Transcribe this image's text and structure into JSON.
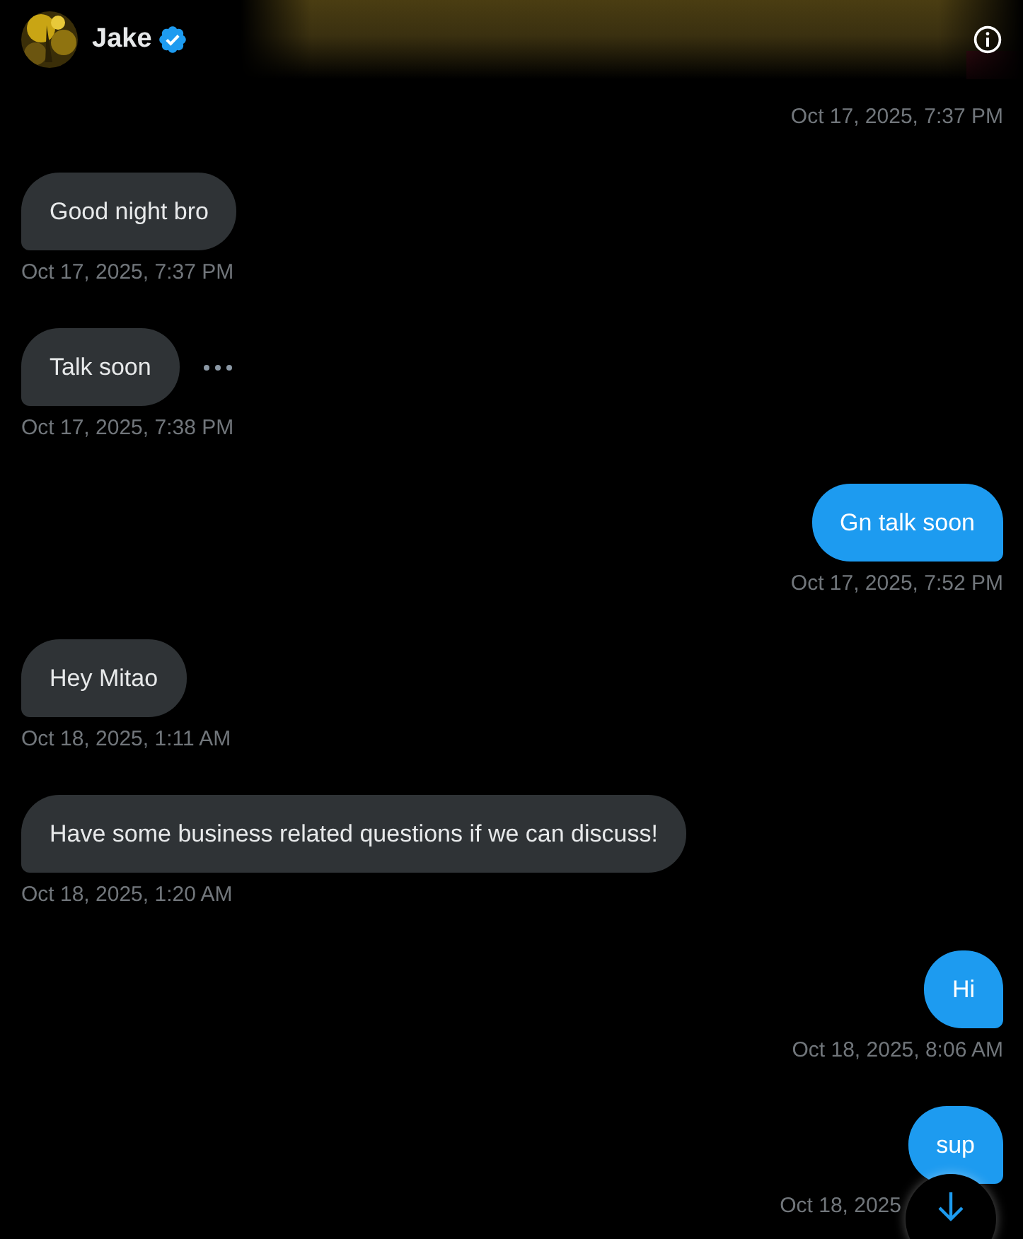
{
  "header": {
    "name": "Jake",
    "verified": true
  },
  "top_timestamp": "Oct 17, 2025, 7:37 PM",
  "messages": [
    {
      "text": "Good night bro",
      "sent": false,
      "show_more": false,
      "timestamp": "Oct 17, 2025, 7:37 PM"
    },
    {
      "text": "Talk soon",
      "sent": false,
      "show_more": true,
      "timestamp": "Oct 17, 2025, 7:38 PM"
    },
    {
      "text": "Gn talk soon",
      "sent": true,
      "show_more": false,
      "timestamp": "Oct 17, 2025, 7:52 PM"
    },
    {
      "text": "Hey Mitao",
      "sent": false,
      "show_more": false,
      "timestamp": "Oct 18, 2025, 1:11 AM"
    },
    {
      "text": "Have some business related questions if we can discuss!",
      "sent": false,
      "show_more": false,
      "timestamp": "Oct 18, 2025, 1:20 AM"
    },
    {
      "text": "Hi",
      "sent": true,
      "show_more": false,
      "timestamp": "Oct 18, 2025, 8:06 AM"
    },
    {
      "text": "sup",
      "sent": true,
      "show_more": false,
      "timestamp": "Oct 18, 2025"
    }
  ]
}
